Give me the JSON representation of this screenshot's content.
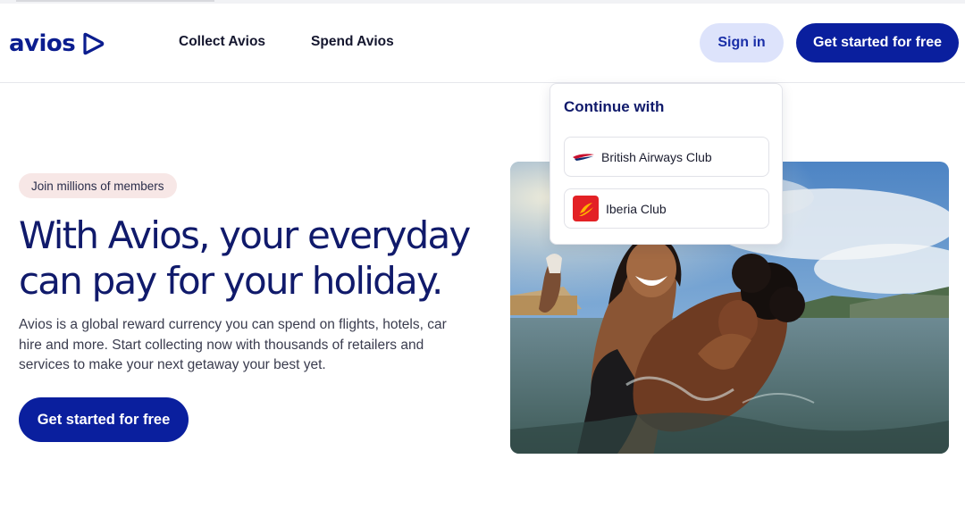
{
  "header": {
    "logo_text": "avios",
    "nav": [
      {
        "label": "Collect Avios"
      },
      {
        "label": "Spend Avios"
      }
    ],
    "signin_label": "Sign in",
    "get_started_label": "Get started for free"
  },
  "hero": {
    "badge": "Join millions of members",
    "title_line1": "With Avios, your everyday",
    "title_line2": "can pay for your holiday.",
    "description": "Avios is a global reward currency you can spend on flights, hotels, car hire and more. Start collecting now with thousands of retailers and services to make your next getaway your best yet.",
    "cta_label": "Get started for free"
  },
  "dropdown": {
    "title": "Continue with",
    "options": [
      {
        "label": "British Airways Club",
        "icon": "british-airways-icon"
      },
      {
        "label": "Iberia Club",
        "icon": "iberia-icon"
      }
    ]
  },
  "colors": {
    "brand_navy": "#0a1f9e",
    "signin_bg": "#dde3fb",
    "badge_bg": "#f7e7e6",
    "iberia_red": "#e32125"
  }
}
